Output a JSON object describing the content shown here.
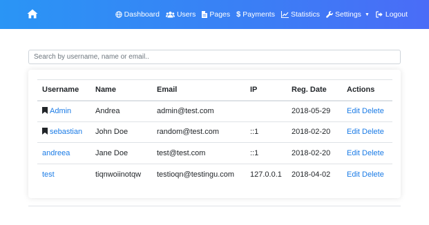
{
  "nav": {
    "home_icon": "home-icon",
    "items": [
      {
        "label": "Dashboard",
        "icon": "globe-icon"
      },
      {
        "label": "Users",
        "icon": "users-icon"
      },
      {
        "label": "Pages",
        "icon": "file-icon"
      },
      {
        "label": "Payments",
        "icon": "dollar-icon"
      },
      {
        "label": "Statistics",
        "icon": "chart-icon"
      },
      {
        "label": "Settings",
        "icon": "wrench-icon",
        "dropdown": true
      },
      {
        "label": "Logout",
        "icon": "sign-out-icon"
      }
    ]
  },
  "search": {
    "placeholder": "Search by username, name or email.."
  },
  "table": {
    "headers": [
      "Username",
      "Name",
      "Email",
      "IP",
      "Reg. Date",
      "Actions"
    ],
    "rows": [
      {
        "username": "Admin",
        "bookmarked": true,
        "name": "Andrea",
        "email": "admin@test.com",
        "ip": "",
        "reg_date": "2018-05-29",
        "edit": "Edit",
        "delete": "Delete"
      },
      {
        "username": "sebastian",
        "bookmarked": true,
        "name": "John Doe",
        "email": "random@test.com",
        "ip": "::1",
        "reg_date": "2018-02-20",
        "edit": "Edit",
        "delete": "Delete"
      },
      {
        "username": "andreea",
        "bookmarked": false,
        "name": "Jane Doe",
        "email": "test@test.com",
        "ip": "::1",
        "reg_date": "2018-02-20",
        "edit": "Edit",
        "delete": "Delete"
      },
      {
        "username": "test",
        "bookmarked": false,
        "name": "tiqnwoiinotqw",
        "email": "testioqn@testingu.com",
        "ip": "127.0.0.1",
        "reg_date": "2018-04-02",
        "edit": "Edit",
        "delete": "Delete"
      }
    ]
  },
  "colors": {
    "navbar_start": "#2a95f5",
    "navbar_end": "#4a6cf7",
    "link": "#1a7be6"
  }
}
